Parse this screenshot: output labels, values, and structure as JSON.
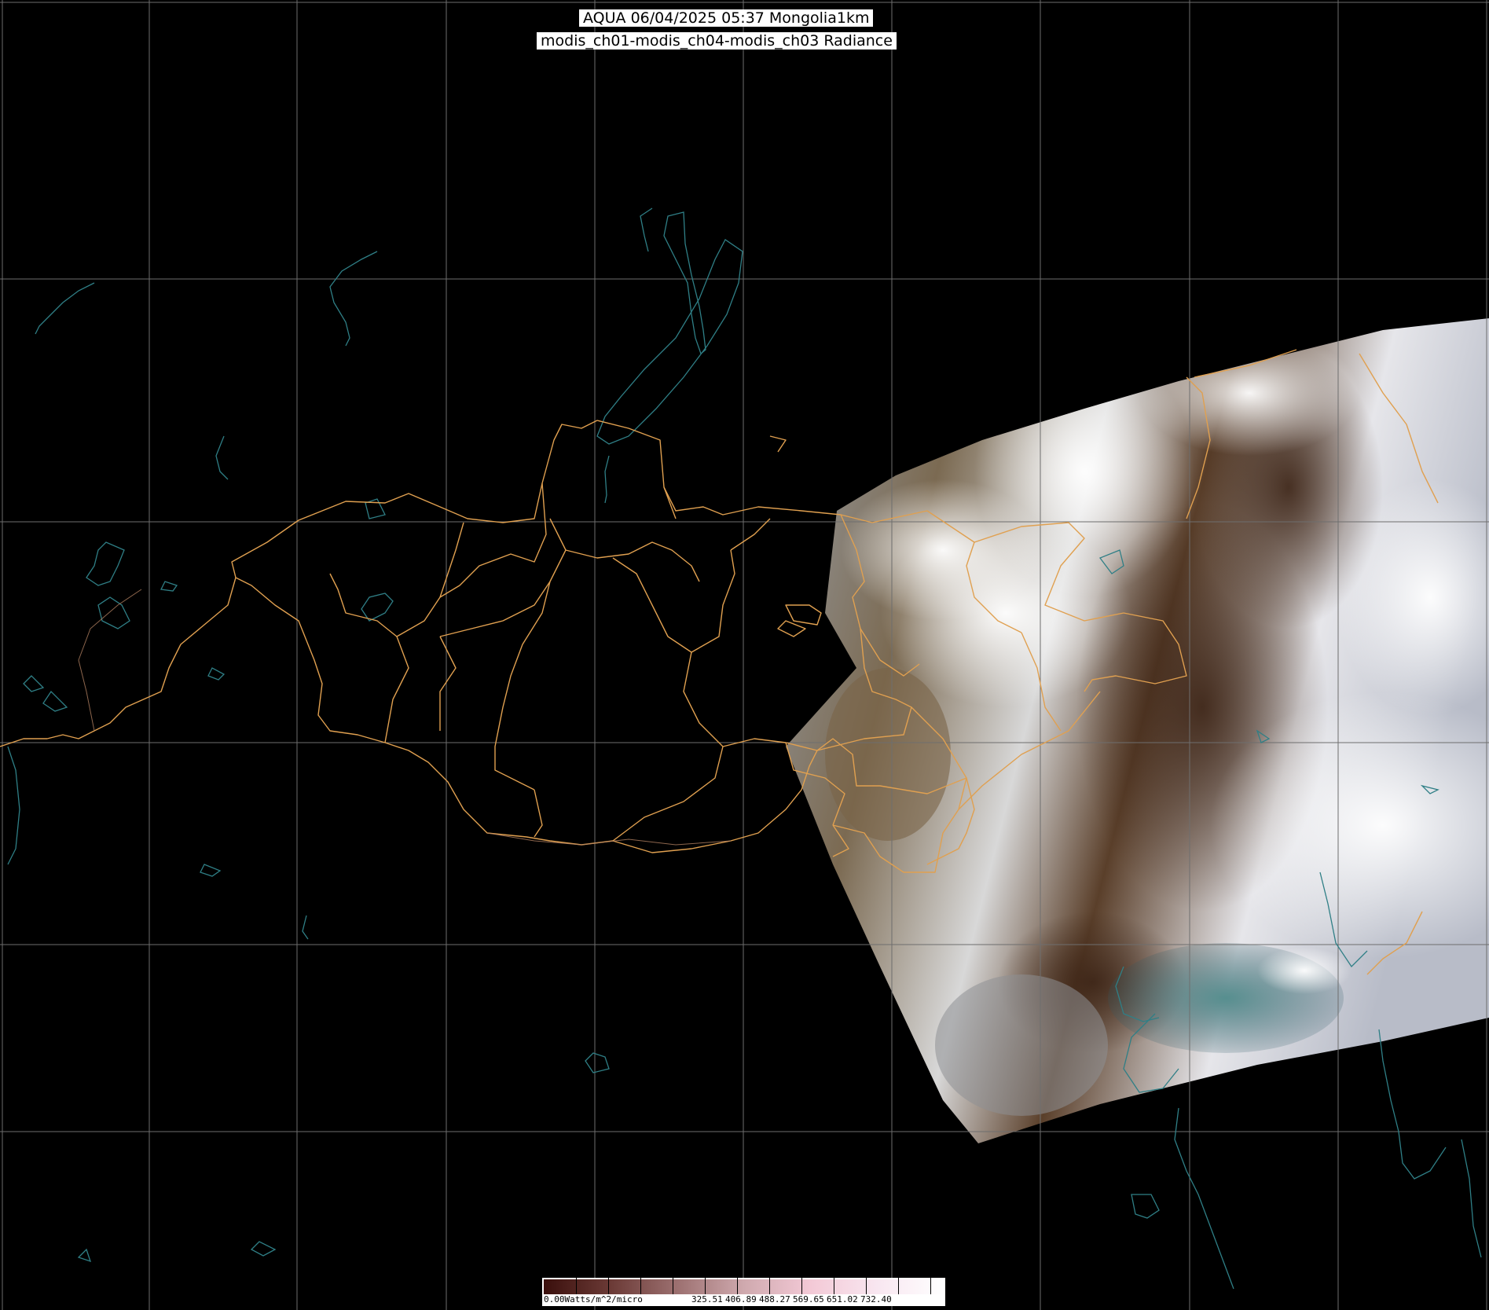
{
  "title": {
    "line1": "AQUA 06/04/2025 05:37 Mongolia1km",
    "line2": "modis_ch01-modis_ch04-modis_ch03 Radiance"
  },
  "colorbar": {
    "unit_label": "0.00Watts/m^2/micro",
    "ticks": [
      "325.51",
      "406.89",
      "488.27",
      "569.65",
      "651.02",
      "732.40"
    ],
    "colors": [
      "#3a0f0c",
      "#6b3a36",
      "#9c7070",
      "#cfa9ae",
      "#f3c9d6",
      "#f8e6f0",
      "#ffffff"
    ]
  },
  "map": {
    "background": "#000000",
    "grid_color": "#6e6e6e",
    "border_color": "#e0a050",
    "coast_color": "#2f7f86"
  }
}
